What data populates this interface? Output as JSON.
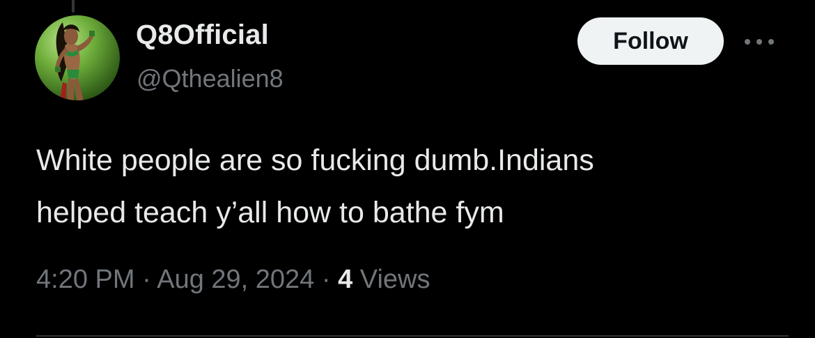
{
  "author": {
    "display_name": "Q8Official",
    "handle": "@Qthealien8",
    "avatar_icon": "character-avatar"
  },
  "actions": {
    "follow_label": "Follow",
    "more_icon": "more-horizontal-icon"
  },
  "tweet": {
    "text": "White people are so fucking dumb.Indians\nhelped teach y’all how to bathe fym"
  },
  "meta": {
    "time": "4:20 PM",
    "separator": "·",
    "date": "Aug 29, 2024",
    "views_count": "4",
    "views_label": "Views"
  },
  "colors": {
    "background": "#000000",
    "primary_text": "#e7e9ea",
    "secondary_text": "#71767b",
    "follow_bg": "#eff3f4",
    "follow_text": "#0f1419"
  }
}
